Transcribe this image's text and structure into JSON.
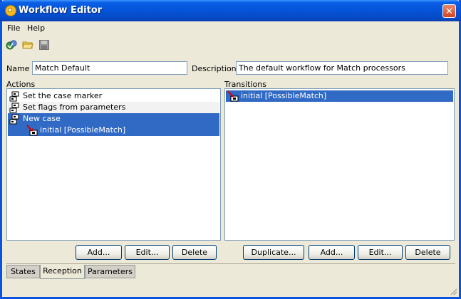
{
  "window": {
    "title": "Workflow Editor",
    "close_glyph": "✕"
  },
  "menu": [
    {
      "label": "File"
    },
    {
      "label": "Help"
    }
  ],
  "toolbar": {
    "icons": [
      "new-workflow-icon",
      "open-folder-icon",
      "save-icon"
    ]
  },
  "form": {
    "name_label": "Name",
    "name_value": "Match Default",
    "description_label": "Description",
    "description_value": "The default workflow for Match processors"
  },
  "actions": {
    "label": "Actions",
    "items": [
      {
        "label": "Set the case marker",
        "icon": "action-icon",
        "selected": false
      },
      {
        "label": "Set flags from parameters",
        "icon": "action-icon",
        "selected": false
      },
      {
        "label": "New case",
        "icon": "action-icon",
        "selected": true
      },
      {
        "label": "initial [PossibleMatch]",
        "icon": "transition-icon",
        "selected": true,
        "child": true
      }
    ],
    "buttons": {
      "add": "Add...",
      "edit": "Edit...",
      "delete": "Delete"
    }
  },
  "transitions": {
    "label": "Transitions",
    "items": [
      {
        "label": "initial [PossibleMatch]",
        "icon": "transition-icon",
        "selected": true
      }
    ],
    "buttons": {
      "duplicate": "Duplicate...",
      "add": "Add...",
      "edit": "Edit...",
      "delete": "Delete"
    }
  },
  "tabs": [
    {
      "label": "States",
      "active": false
    },
    {
      "label": "Reception",
      "active": true
    },
    {
      "label": "Parameters",
      "active": false
    }
  ],
  "colors": {
    "selection": "#316ac5",
    "title_bar": "#0553d8",
    "window_bg": "#ece9d8"
  }
}
